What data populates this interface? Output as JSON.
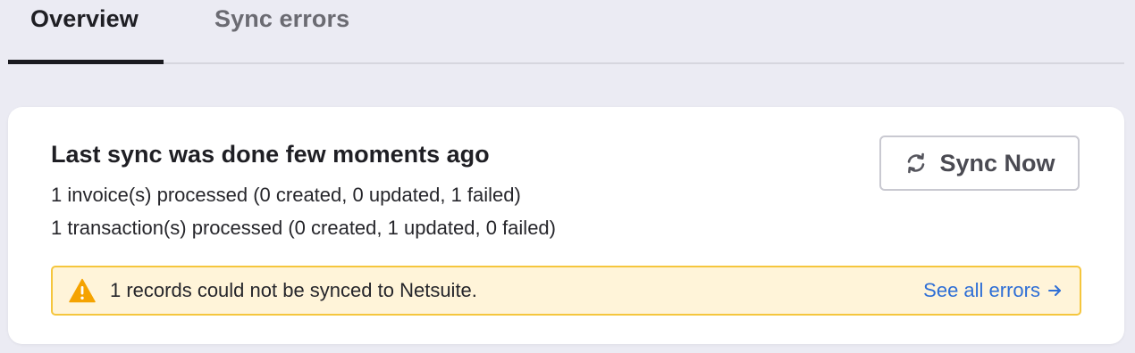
{
  "tabs": [
    {
      "label": "Overview",
      "active": true
    },
    {
      "label": "Sync errors",
      "active": false
    }
  ],
  "summary": {
    "title": "Last sync was done few moments ago",
    "invoices_line": "1 invoice(s) processed (0 created, 0 updated, 1 failed)",
    "transactions_line": "1 transaction(s) processed (0 created, 1 updated, 0 failed)"
  },
  "sync_button": {
    "label": "Sync Now",
    "icon": "refresh-icon"
  },
  "alert": {
    "icon": "warning-icon",
    "message": "1 records could not be synced to Netsuite.",
    "link_label": "See all errors",
    "link_icon": "arrow-right-icon"
  },
  "colors": {
    "page_background": "#ebebf3",
    "card_background": "#ffffff",
    "alert_background": "#fff4d9",
    "alert_border": "#f5c63d",
    "warning_icon": "#f5a300",
    "link": "#2f6fd6",
    "active_tab_indicator": "#1a1a1f"
  }
}
